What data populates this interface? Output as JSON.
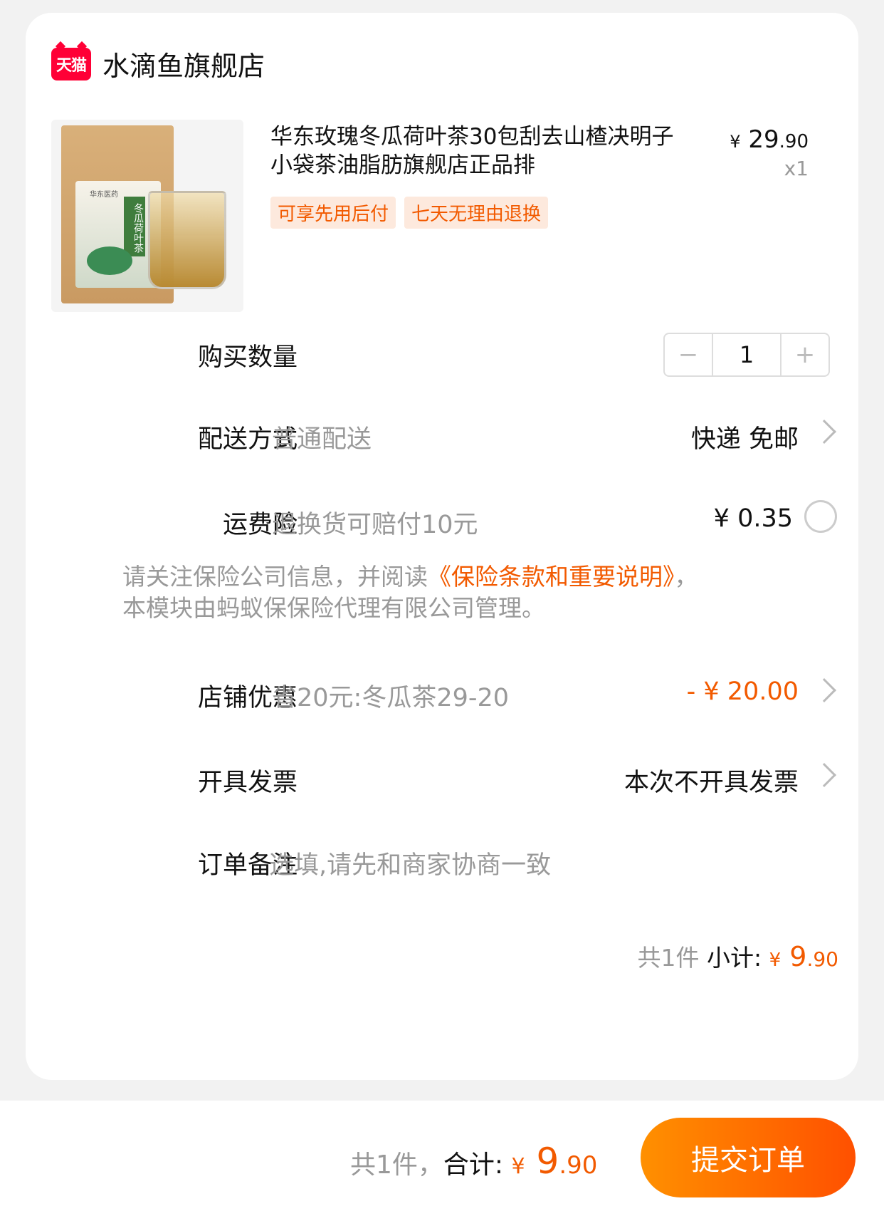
{
  "store": {
    "logo_text": "天猫",
    "name": "水滴鱼旗舰店"
  },
  "product": {
    "title": "华东玫瑰冬瓜荷叶茶30包刮去山楂决明子小袋茶油脂肪旗舰店正品排",
    "price_symbol": "¥",
    "price_int": "29",
    "price_dec": ".90",
    "quantity": "x1",
    "tags": [
      "可享先用后付",
      "七天无理由退换"
    ],
    "image_label": "冬瓜荷叶茶",
    "image_brand": "华东医药"
  },
  "quantity_row": {
    "label": "购买数量",
    "minus": "−",
    "value": "1",
    "plus": "+"
  },
  "delivery": {
    "label": "配送方式",
    "sub": "普通配送",
    "value": "快递 免邮"
  },
  "insurance": {
    "label": "运费险",
    "sub": "退换货可赔付10元",
    "value": "¥ 0.35"
  },
  "notice": {
    "prefix": "请关注保险公司信息，并阅读",
    "link": "《保险条款和重要说明》",
    "suffix": "，本模块由蚂蚁保保险代理有限公司管理。"
  },
  "discount": {
    "label": "店铺优惠",
    "sub": "省20元:冬瓜茶29-20",
    "value": "- ¥ 20.00"
  },
  "invoice": {
    "label": "开具发票",
    "value": "本次不开具发票"
  },
  "remark": {
    "label": "订单备注",
    "placeholder": "选填,请先和商家协商一致"
  },
  "subtotal": {
    "count": "共1件",
    "label": "小计:",
    "symbol": "¥",
    "int": "9",
    "dec": ".90"
  },
  "footer": {
    "count": "共1件，",
    "label": "合计:",
    "symbol": "¥",
    "int": "9",
    "dec": ".90",
    "submit": "提交订单"
  }
}
